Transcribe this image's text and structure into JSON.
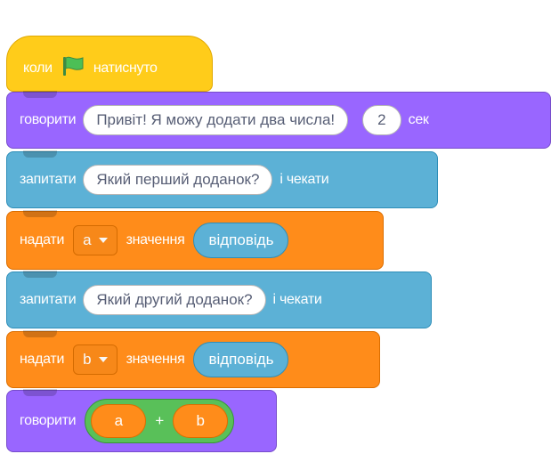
{
  "blocks": {
    "when_flag": {
      "label_before": "коли",
      "label_after": "натиснуто"
    },
    "say_for": {
      "label": "говорити",
      "message": "Привіт! Я можу додати два числа!",
      "seconds": "2",
      "unit": "сек"
    },
    "ask_first": {
      "label": "запитати",
      "question": "Який перший доданок?",
      "suffix": "і чекати"
    },
    "set_a": {
      "label": "надати",
      "variable": "a",
      "value_label": "значення",
      "value": "відповідь"
    },
    "ask_second": {
      "label": "запитати",
      "question": "Який другий доданок?",
      "suffix": "і чекати"
    },
    "set_b": {
      "label": "надати",
      "variable": "b",
      "value_label": "значення",
      "value": "відповідь"
    },
    "say_sum": {
      "label": "говорити",
      "left": "a",
      "operator": "+",
      "right": "b"
    }
  },
  "icons": {
    "flag": "green-flag-icon",
    "dropdown": "caret-down-icon"
  },
  "colors": {
    "events": "#ffcc1a",
    "looks": "#9966ff",
    "sensing": "#5cb1d6",
    "variables": "#ff8c1a",
    "operators": "#59c059",
    "flag": "#4cbf56"
  }
}
